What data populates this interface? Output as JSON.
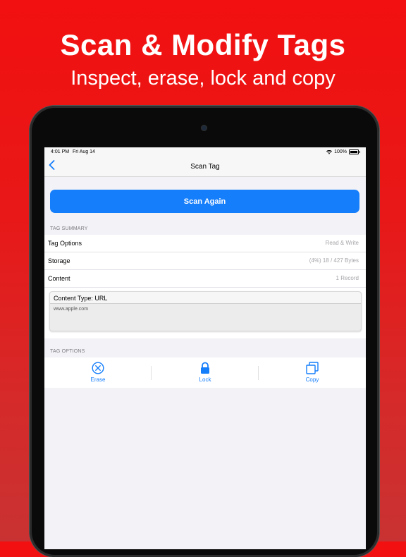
{
  "promo": {
    "headline": "Scan & Modify Tags",
    "subheadline": "Inspect, erase, lock and copy"
  },
  "status_bar": {
    "time": "4:01 PM",
    "date": "Fri Aug 14",
    "battery_text": "100%",
    "battery_level_pct": 100
  },
  "nav": {
    "title": "Scan Tag",
    "back_icon": "chevron-left-icon"
  },
  "actions": {
    "scan_again": "Scan Again"
  },
  "summary": {
    "header": "TAG SUMMARY",
    "rows": [
      {
        "label": "Tag Options",
        "value": "Read & Write"
      },
      {
        "label": "Storage",
        "value": "(4%) 18 / 427 Bytes"
      },
      {
        "label": "Content",
        "value": "1 Record"
      }
    ]
  },
  "content_record": {
    "type_label": "Content Type: URL",
    "value": "www.apple.com"
  },
  "tag_options": {
    "header": "TAG OPTIONS",
    "items": [
      {
        "label": "Erase",
        "icon": "x-circle-icon"
      },
      {
        "label": "Lock",
        "icon": "lock-icon"
      },
      {
        "label": "Copy",
        "icon": "copy-icon"
      }
    ]
  },
  "colors": {
    "accent": "#157efb",
    "background_red": "#e81818"
  }
}
